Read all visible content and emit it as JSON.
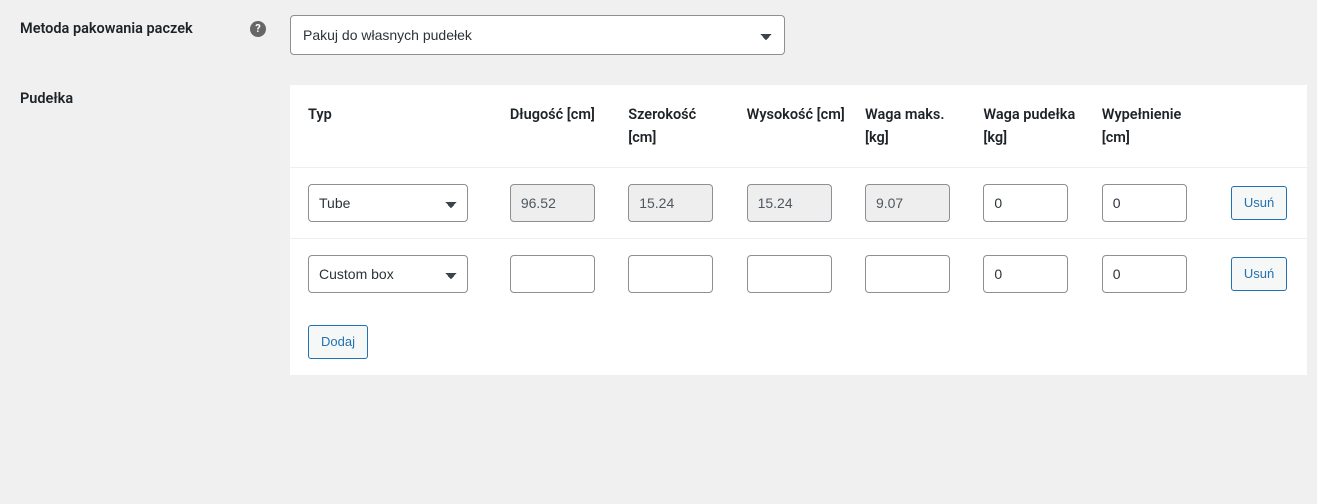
{
  "labels": {
    "packing_method": "Metoda pakowania paczek",
    "boxes": "Pudełka"
  },
  "packing_method_select": {
    "selected": "Pakuj do własnych pudełek"
  },
  "buttons": {
    "remove": "Usuń",
    "add": "Dodaj"
  },
  "columns": {
    "type": "Typ",
    "length": "Długość [cm]",
    "width": "Szerokość [cm]",
    "height": "Wysokość [cm]",
    "max_weight": "Waga maks. [kg]",
    "box_weight": "Waga pudełka [kg]",
    "padding": "Wypełnienie [cm]"
  },
  "rows": [
    {
      "type": "Tube",
      "length": "96.52",
      "width": "15.24",
      "height": "15.24",
      "max_weight": "9.07",
      "box_weight": "0",
      "padding": "0",
      "readonly": true
    },
    {
      "type": "Custom box",
      "length": "",
      "width": "",
      "height": "",
      "max_weight": "",
      "box_weight": "0",
      "padding": "0",
      "readonly": false
    }
  ]
}
